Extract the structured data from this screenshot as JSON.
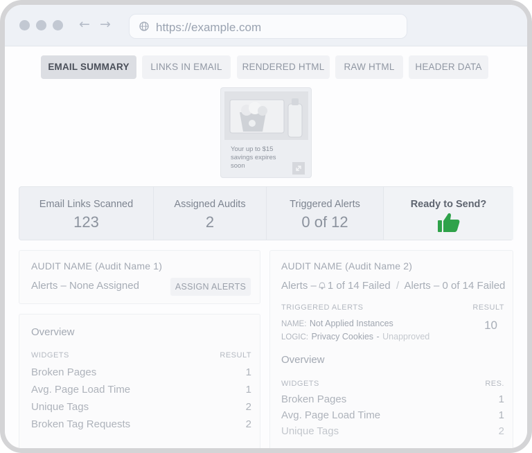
{
  "browser": {
    "url": "https://example.com"
  },
  "tabs": [
    {
      "label": "EMAIL SUMMARY",
      "active": true
    },
    {
      "label": "LINKS IN EMAIL",
      "active": false
    },
    {
      "label": "RENDERED HTML",
      "active": false
    },
    {
      "label": "RAW HTML",
      "active": false
    },
    {
      "label": "HEADER DATA",
      "active": false
    }
  ],
  "preview": {
    "text": "Your up to $15 savings expires soon"
  },
  "stats": {
    "links_scanned_label": "Email Links Scanned",
    "links_scanned_value": "123",
    "assigned_audits_label": "Assigned Audits",
    "assigned_audits_value": "2",
    "triggered_alerts_label": "Triggered Alerts",
    "triggered_alerts_value": "0 of 12",
    "ready_label": "Ready to Send?",
    "ready_icon": "thumbs-up-icon",
    "ready_color": "#2fa24a"
  },
  "audit1": {
    "name": "AUDIT NAME (Audit Name 1)",
    "alerts": "Alerts – None Assigned",
    "assign_button": "ASSIGN ALERTS",
    "overview_title": "Overview",
    "col_widgets": "WIDGETS",
    "col_result": "RESULT",
    "rows": [
      {
        "label": "Broken Pages",
        "value": "1"
      },
      {
        "label": "Avg. Page Load Time",
        "value": "1"
      },
      {
        "label": "Unique Tags",
        "value": "2"
      },
      {
        "label": "Broken Tag Requests",
        "value": "2"
      }
    ]
  },
  "audit2": {
    "name": "AUDIT NAME (Audit Name 2)",
    "alerts_prefix": "Alerts –",
    "alerts_failed_1": "1 of 14 Failed",
    "alerts_separator": "/",
    "alerts_prefix_2": "Alerts –",
    "alerts_failed_2": "0 of 14",
    "alerts_failed_2_suffix": "Failed",
    "triggered_title": "TRIGGERED ALERTS",
    "result_title": "RESULT",
    "name_label": "NAME:",
    "name_value": "Not Applied Instances",
    "logic_label": "LOGIC:",
    "logic_value": "Privacy Cookies",
    "logic_sep": "-",
    "logic_status": "Unapproved",
    "result_value": "10",
    "overview_title": "Overview",
    "col_widgets": "WIDGETS",
    "col_result": "RES.",
    "rows": [
      {
        "label": "Broken Pages",
        "value": "1"
      },
      {
        "label": "Avg. Page Load Time",
        "value": "1"
      },
      {
        "label": "Unique Tags",
        "value": "2"
      }
    ]
  }
}
